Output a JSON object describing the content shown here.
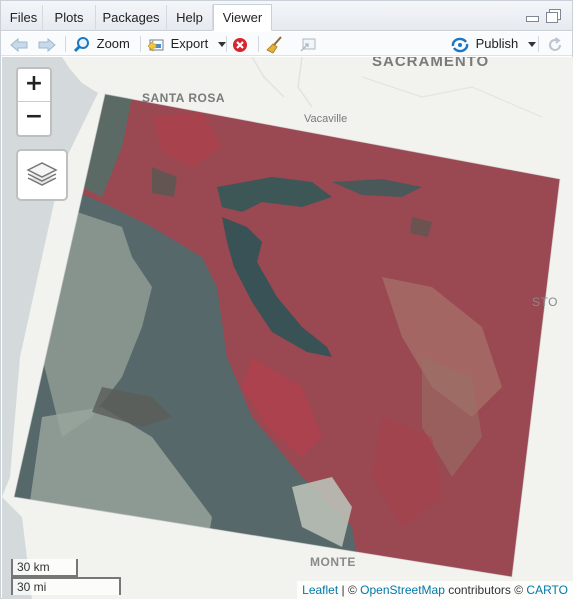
{
  "tabs": [
    {
      "label": "Files",
      "active": false
    },
    {
      "label": "Plots",
      "active": false
    },
    {
      "label": "Packages",
      "active": false
    },
    {
      "label": "Help",
      "active": false
    },
    {
      "label": "Viewer",
      "active": true
    }
  ],
  "toolbar": {
    "zoom_label": "Zoom",
    "export_label": "Export",
    "publish_label": "Publish"
  },
  "map": {
    "places": {
      "sacramento": "SACRAMENTO",
      "santa_rosa": "SANTA ROSA",
      "vacaville": "Vacaville",
      "stockton_partial": "STO",
      "monterey_partial": "MONTE"
    },
    "zoom_in": "+",
    "zoom_out": "−",
    "scale_km": "30 km",
    "scale_mi": "30 mi",
    "attribution": {
      "leaflet": "Leaflet",
      "sep1": " | © ",
      "osm": "OpenStreetMap",
      "contributors": " contributors © ",
      "carto": "CARTO"
    }
  },
  "colors": {
    "accent": "#1a78c2",
    "link": "#0078a8",
    "raster_red": "#a8424c",
    "raster_water": "#2f4a52"
  }
}
